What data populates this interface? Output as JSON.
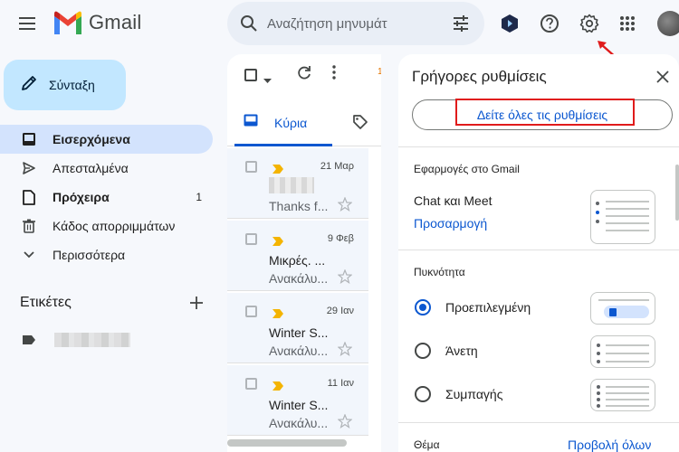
{
  "app": {
    "name": "Gmail"
  },
  "search": {
    "placeholder": "Αναζήτηση μηνυμάτ"
  },
  "compose": {
    "label": "Σύνταξη"
  },
  "nav": [
    {
      "label": "Εισερχόμενα",
      "icon": "inbox-icon",
      "active": true
    },
    {
      "label": "Απεσταλμένα",
      "icon": "send-icon"
    },
    {
      "label": "Πρόχειρα",
      "icon": "draft-icon",
      "count": "1"
    },
    {
      "label": "Κάδος απορριμμάτων",
      "icon": "trash-icon"
    },
    {
      "label": "Περισσότερα",
      "icon": "chevron-down-icon"
    }
  ],
  "labels": {
    "heading": "Ετικέτες",
    "add_icon": "plus-icon"
  },
  "list": {
    "tab_primary": "Κύρια",
    "rows": [
      {
        "date": "21 Μαρ",
        "sender": "",
        "snippet": "Thanks f..."
      },
      {
        "date": "9 Φεβ",
        "sender": "Μικρές. ...",
        "snippet": "Ανακάλυ..."
      },
      {
        "date": "29 Ιαν",
        "sender": "Winter S...",
        "snippet": "Ανακάλυ..."
      },
      {
        "date": "11 Ιαν",
        "sender": "Winter S...",
        "snippet": "Ανακάλυ..."
      }
    ]
  },
  "quick_settings": {
    "title": "Γρήγορες ρυθμίσεις",
    "see_all": "Δείτε όλες τις ρυθμίσεις",
    "apps_section": "Εφαρμογές στο Gmail",
    "chat_meet": "Chat και Meet",
    "customize": "Προσαρμογή",
    "density_section": "Πυκνότητα",
    "density_options": [
      "Προεπιλεγμένη",
      "Άνετη",
      "Συμπαγής"
    ],
    "density_selected": "Προεπιλεγμένη",
    "theme_section": "Θέμα",
    "view_all": "Προβολή όλων"
  },
  "colors": {
    "accent": "#0b57d0",
    "compose_bg": "#c2e7ff",
    "highlight": "#e01b1b"
  }
}
